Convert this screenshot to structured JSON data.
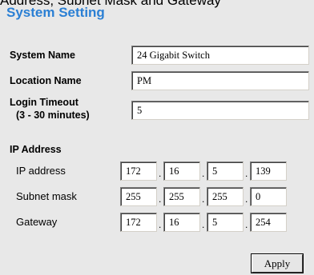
{
  "header_fragment": "Address, Subnet Mask and Gateway",
  "title": "System Setting",
  "system_name": {
    "label": "System Name",
    "value": "24 Gigabit Switch"
  },
  "location_name": {
    "label": "Location Name",
    "value": "PM"
  },
  "login_timeout": {
    "label": "Login Timeout",
    "sublabel": "(3 - 30 minutes)",
    "value": "5"
  },
  "ip_section": {
    "heading": "IP Address",
    "ip_address": {
      "label": "IP address",
      "octets": [
        "172",
        "16",
        "5",
        "139"
      ]
    },
    "subnet_mask": {
      "label": "Subnet mask",
      "octets": [
        "255",
        "255",
        "255",
        "0"
      ]
    },
    "gateway": {
      "label": "Gateway",
      "octets": [
        "172",
        "16",
        "5",
        "254"
      ]
    },
    "separator": "."
  },
  "apply_label": "Apply",
  "colors": {
    "title": "#2a7fd4",
    "panel_background": "#e8e8e8"
  }
}
